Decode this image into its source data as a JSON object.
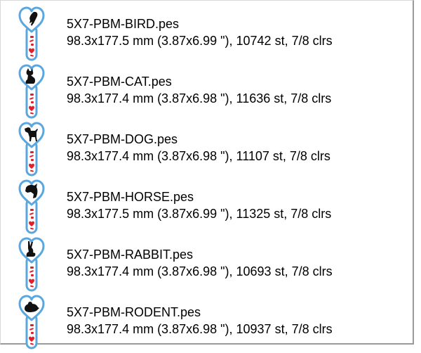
{
  "colors": {
    "outline": "#5aa6de",
    "accent": "#e0202a",
    "silhouette": "#111111"
  },
  "files": [
    {
      "name": "5X7-PBM-BIRD.pes",
      "info": "98.3x177.5 mm (3.87x6.99 \"), 10742 st, 7/8 clrs",
      "icon": "bird-silhouette-icon"
    },
    {
      "name": "5X7-PBM-CAT.pes",
      "info": "98.3x177.4 mm (3.87x6.98 \"), 11636 st, 7/8 clrs",
      "icon": "cat-silhouette-icon"
    },
    {
      "name": "5X7-PBM-DOG.pes",
      "info": "98.3x177.4 mm (3.87x6.98 \"), 11107 st, 7/8 clrs",
      "icon": "dog-silhouette-icon"
    },
    {
      "name": "5X7-PBM-HORSE.pes",
      "info": "98.3x177.5 mm (3.87x6.99 \"), 11325 st, 7/8 clrs",
      "icon": "horse-silhouette-icon"
    },
    {
      "name": "5X7-PBM-RABBIT.pes",
      "info": "98.3x177.4 mm (3.87x6.98 \"), 10693 st, 7/8 clrs",
      "icon": "rabbit-silhouette-icon"
    },
    {
      "name": "5X7-PBM-RODENT.pes",
      "info": "98.3x177.4 mm (3.87x6.98 \"), 10937 st, 7/8 clrs",
      "icon": "rodent-silhouette-icon"
    }
  ]
}
